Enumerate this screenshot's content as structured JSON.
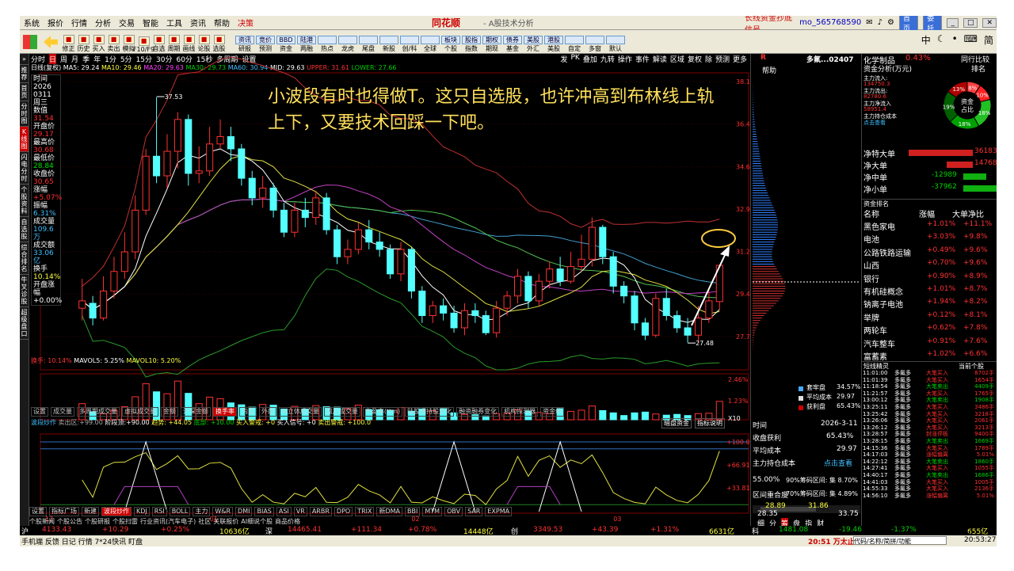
{
  "menu": [
    "系统",
    "报价",
    "行情",
    "分析",
    "交易",
    "智能",
    "工具",
    "资讯",
    "帮助",
    "决策"
  ],
  "brand": "同花顺",
  "app_title": "- A股技术分析",
  "top_right": {
    "signal": "长线资金抄底信号",
    "user": "mo_565768590",
    "btns": [
      "首页",
      "委托"
    ]
  },
  "toolbar": [
    {
      "l": "修正"
    },
    {
      "l": "历史"
    },
    {
      "l": "买入"
    },
    {
      "l": "卖出"
    },
    {
      "l": "模拟"
    },
    {
      "l": "F10/F9"
    },
    {
      "l": "自选"
    },
    {
      "l": "周期"
    },
    {
      "l": "画线"
    },
    {
      "l": "论股"
    },
    {
      "l": "选股"
    }
  ],
  "toolbar2": [
    {
      "t": "资讯",
      "l": "研报"
    },
    {
      "t": "竞价",
      "l": "预测"
    },
    {
      "t": "BBD",
      "l": "资金"
    },
    {
      "t": "陆港",
      "l": "两融"
    },
    {
      "t": "",
      "l": "热点"
    },
    {
      "t": "",
      "l": "龙虎"
    },
    {
      "t": "",
      "l": "尾盘"
    },
    {
      "t": "",
      "l": "新股"
    },
    {
      "t": "",
      "l": "创/科"
    },
    {
      "t": "",
      "l": "全球"
    },
    {
      "t": "板块",
      "l": "个股"
    },
    {
      "t": "股指",
      "l": "指数"
    },
    {
      "t": "期权",
      "l": "期现"
    },
    {
      "t": "债券",
      "l": "基金"
    },
    {
      "t": "美股",
      "l": "外汇"
    },
    {
      "t": "港股",
      "l": "美股"
    },
    {
      "t": "",
      "l": "自定"
    },
    {
      "t": "",
      "l": "多窗"
    },
    {
      "t": "",
      "l": "默认"
    }
  ],
  "side_tabs": [
    "分时图",
    "K线图",
    "闪电分时",
    "个股资料",
    "自选股",
    "综合排名",
    "牛叉诊股",
    "超级盘口"
  ],
  "period_bar": [
    "分时",
    "日",
    "周",
    "月",
    "季",
    "年",
    "1分",
    "5分",
    "15分",
    "30分",
    "60分",
    "15秒",
    "多周期",
    "设置"
  ],
  "period_right": [
    "发",
    "PK",
    "叠加",
    "九转",
    "操作",
    "事件",
    "解读",
    "区域",
    "复权",
    "除",
    "预测",
    "更多"
  ],
  "legend": {
    "stock": "日线(复权)",
    "ma5": "MA5: 29.24",
    "ma10": "MA10: 29.46",
    "ma20": "MA20: 29.63",
    "ma30": "MA30: 29.73",
    "ma60": "MA60: 30.94",
    "mid": "MID: 29.63",
    "upper": "UPPER: 31.61",
    "lower": "LOWER: 27.66"
  },
  "info": [
    {
      "k": "时间",
      "v": "2026"
    },
    {
      "k": "",
      "v": "0311"
    },
    {
      "k": "周三",
      "v": ""
    },
    {
      "k": "数值",
      "v": "31.54"
    },
    {
      "k": "开盘价",
      "v": "29.17"
    },
    {
      "k": "最高价",
      "v": "30.68"
    },
    {
      "k": "最低价",
      "v": "28.84"
    },
    {
      "k": "收盘价",
      "v": "30.65"
    },
    {
      "k": "涨幅",
      "v": "+5.07%"
    },
    {
      "k": "振幅",
      "v": "6.31%"
    },
    {
      "k": "成交量",
      "v": "109.6万"
    },
    {
      "k": "成交额",
      "v": "33.06亿"
    },
    {
      "k": "换手",
      "v": "10.14%"
    },
    {
      "k": "开盘涨幅",
      "v": "+0.00%"
    }
  ],
  "annotation": "小波段有时也得做T。这只自选股，也许冲高到布林线上轨上下，又要技术回踩一下吧。",
  "price_axis": [
    "38.14",
    "36.41",
    "34.67",
    "32.94",
    "31.21",
    "29.48",
    "27.75"
  ],
  "price_labels": {
    "high": "37.53",
    "low": "27.48"
  },
  "vol_legend": {
    "turn": "换手: 10.14%",
    "mavol5": "MAVOL5: 5.25%",
    "mavol10": "MAVOL10: 5.20%"
  },
  "vol_axis": [
    "2.46%",
    "1.23%",
    "X10"
  ],
  "ind_tabs": [
    "设置",
    "成交量",
    "多周期成交量",
    "虚拟成交量",
    "金额",
    "沪深金额",
    "换手率",
    "内盘",
    "外盘",
    "AI立体成交量",
    "盘后成交量",
    "市盈率(ttm)",
    "陆股通持股变化",
    "融资融券变化",
    "机构探测器",
    "资金统"
  ],
  "ind2_legend": {
    "name": "波段炒作",
    "a": "卖出区:+99.00",
    "b": "阶段顶:+90.00",
    "c": "趋势: +44.05",
    "d": "底部: +10.00",
    "e": "买入警戒: +0",
    "f": "买入信号: +0",
    "g": "卖出警戒: +100.0"
  },
  "ind2_right": [
    "暗盘资金",
    "指标说明"
  ],
  "ind2_axis": [
    "+100.0",
    "+66.91",
    "+33.81"
  ],
  "date_axis": [
    "12",
    "01",
    "02",
    "03"
  ],
  "bottom_tabs": [
    "设置",
    "指标广场",
    "新建",
    "波段炒作",
    "KDJ",
    "RSI",
    "BOLL",
    "主力",
    "W&R",
    "DMI",
    "BIAS",
    "ASI",
    "VR",
    "ARBR",
    "DPO",
    "TRIX",
    "新DMA",
    "BBI",
    "MTM",
    "OBV",
    "SAR",
    "EXPMA"
  ],
  "bottom_tabs2": [
    "个股新闻",
    "个股公告",
    "个股研报",
    "个股扫雷",
    "行业资讯(汽车电子)",
    "社区",
    "关联报价",
    "AI细说个股",
    "商品价格"
  ],
  "index_bar": {
    "sh": "沪",
    "sh_v": "4133.43",
    "sh_c": "+10.29",
    "sh_p": "+0.25%",
    "sh_a": "10636亿",
    "sz": "深",
    "sz_v": "14465.41",
    "sz_c": "+111.34",
    "sz_p": "+0.78%",
    "sz_a": "14448亿",
    "cy": "创",
    "cy_v": "3349.53",
    "cy_c": "+43.39",
    "cy_p": "+1.31%",
    "cy_a": "6631亿",
    "kc": "科",
    "kc_v": "1481.08",
    "kc_c": "-19.46",
    "kc_p": "-1.37%",
    "kc_a": "655亿"
  },
  "status": {
    "left": "手机端 反馈 日记 行情 7*24快讯 盯盘",
    "time": "20:51 万太止美",
    "search": "代码/名称/简拼/功能",
    "clock": "20:53:27",
    "clock2": "20:53"
  },
  "mid_panel": {
    "code": "R",
    "name": "多氟...02407",
    "help": "帮助",
    "chip_legend": [
      {
        "k": "套牢盘",
        "v": "34.57%"
      },
      {
        "k": "平均成本",
        "v": "29.97"
      },
      {
        "k": "获利盘",
        "v": "65.43%"
      }
    ],
    "date_k": "时间",
    "date_v": "2026-3-11",
    "profit_k": "收盘获利",
    "profit_v": "65.43%",
    "avg_k": "平均成本",
    "avg_v": "29.97",
    "main_k": "主力持仓成本",
    "main_v": "点击查看",
    "r90": "55.00%",
    "r90_t": "90%筹码区间: 集 8.70%",
    "r70": "区间重合度",
    "r70_t": "70%筹码区间: 集 4.89%",
    "lo": "28.89",
    "hi": "31.86",
    "lo2": "28.35",
    "hi2": "33.75",
    "tabs": [
      "细",
      "分",
      "筹",
      "盘",
      "指",
      "财"
    ]
  },
  "right_panel": {
    "sector": "化学制品",
    "sector_p": "0.43%",
    "ops": [
      "同行比较",
      "排名"
    ],
    "flow_title": "资金分析(万元)",
    "flow": [
      {
        "k": "主力流入:",
        "v": "134750.3"
      },
      {
        "k": "主力流出:",
        "v": "82780.6"
      },
      {
        "k": "主力净流入",
        "v": "58951.4"
      },
      {
        "k": "主力持仓成本",
        "v": "点击查看"
      }
    ],
    "pie": [
      {
        "l": "8%"
      },
      {
        "l": "10%"
      },
      {
        "l": "18%"
      },
      {
        "l": "18%"
      },
      {
        "l": "19%"
      },
      {
        "l": "13%"
      }
    ],
    "pie_center": "资金\n占比",
    "net": [
      {
        "k": "净特大单",
        "v": "36183"
      },
      {
        "k": "净大单",
        "v": "14768"
      },
      {
        "k": "净中单",
        "v": "-12989"
      },
      {
        "k": "净小单",
        "v": "-37962"
      }
    ],
    "rank_title": "资金排名",
    "rank_head": [
      "名称",
      "涨幅",
      "大单净比"
    ],
    "rank": [
      {
        "n": "黑色家电",
        "p": "+1.01%",
        "v": "+11.1%"
      },
      {
        "n": "电池",
        "p": "+3.03%",
        "v": "+9.8%"
      },
      {
        "n": "公路铁路运输",
        "p": "+0.49%",
        "v": "+9.6%"
      },
      {
        "n": "山西",
        "p": "+0.70%",
        "v": "+9.6%"
      },
      {
        "n": "银行",
        "p": "+0.90%",
        "v": "+8.9%"
      },
      {
        "n": "有机硅概念",
        "p": "+1.01%",
        "v": "+8.7%"
      },
      {
        "n": "钠离子电池",
        "p": "+1.94%",
        "v": "+8.2%"
      },
      {
        "n": "举牌",
        "p": "+0.12%",
        "v": "+8.1%"
      },
      {
        "n": "两轮车",
        "p": "+0.62%",
        "v": "+7.8%"
      },
      {
        "n": "汽车整车",
        "p": "+0.91%",
        "v": "+7.6%"
      },
      {
        "n": "富蓄素",
        "p": "+1.02%",
        "v": "+6.6%"
      }
    ],
    "trade_title": "短线精灵",
    "trade_filter": "当前个股",
    "trades": [
      {
        "t": "11:01:00",
        "n": "多氟多",
        "a": "大笔买入",
        "v": "8702手"
      },
      {
        "t": "11:01:39",
        "n": "多氟多",
        "a": "大笔买入",
        "v": "1654手"
      },
      {
        "t": "11:18:54",
        "n": "多氟多",
        "a": "大笔卖出",
        "v": "4409手"
      },
      {
        "t": "11:21:57",
        "n": "多氟多",
        "a": "大笔买入",
        "v": "1765手"
      },
      {
        "t": "13:00:12",
        "n": "多氟多",
        "a": "大笔卖出",
        "v": "1908手"
      },
      {
        "t": "13:25:11",
        "n": "多氟多",
        "a": "大笔买入",
        "v": "3486手"
      },
      {
        "t": "13:25:42",
        "n": "多氟多",
        "a": "大笔买入",
        "v": "3218手"
      },
      {
        "t": "13:26:06",
        "n": "多氟多",
        "a": "大笔买入",
        "v": "2061手"
      },
      {
        "t": "13:26:12",
        "n": "多氟多",
        "a": "大笔买入",
        "v": "3213手"
      },
      {
        "t": "13:28:57",
        "n": "多氟多",
        "a": "封涨停板",
        "v": "9400手"
      },
      {
        "t": "13:28:15",
        "n": "多氟多",
        "a": "大笔卖出",
        "v": "1669手"
      },
      {
        "t": "14:15:36",
        "n": "多氟多",
        "a": "大笔买入",
        "v": "1789手"
      },
      {
        "t": "14:17:03",
        "n": "多氟多",
        "a": "涨幅偏离",
        "v": "5.01%"
      },
      {
        "t": "14:22:12",
        "n": "多氟多",
        "a": "大笔卖出",
        "v": "1860手"
      },
      {
        "t": "14:27:41",
        "n": "多氟多",
        "a": "大笔买入",
        "v": "1055手"
      },
      {
        "t": "14:40:17",
        "n": "多氟多",
        "a": "大笔卖出",
        "v": "1686手"
      },
      {
        "t": "14:41:03",
        "n": "多氟多",
        "a": "大笔买入",
        "v": "1005手"
      },
      {
        "t": "14:55:33",
        "n": "多氟多",
        "a": "大笔买入",
        "v": "2136手"
      },
      {
        "t": "14:56:10",
        "n": "多氟多",
        "a": "涨幅偏离",
        "v": "5.01%"
      }
    ]
  },
  "chart_data": {
    "type": "candlestick",
    "title": "日线(复权)",
    "ylim": [
      27.0,
      38.5
    ],
    "candles": [
      [
        28.9,
        29.2,
        30.1,
        28.4
      ],
      [
        29.1,
        28.5,
        29.4,
        28.2
      ],
      [
        28.5,
        29.6,
        30.2,
        28.4
      ],
      [
        29.6,
        30.4,
        31.0,
        29.3
      ],
      [
        30.4,
        31.2,
        32.0,
        30.1
      ],
      [
        31.2,
        32.9,
        33.5,
        30.9
      ],
      [
        32.9,
        35.1,
        35.4,
        32.7
      ],
      [
        35.1,
        34.3,
        37.5,
        34.0
      ],
      [
        34.3,
        35.3,
        36.0,
        33.8
      ],
      [
        35.3,
        36.6,
        36.9,
        34.6
      ],
      [
        36.6,
        34.4,
        36.8,
        33.9
      ],
      [
        34.4,
        34.5,
        35.5,
        34.0
      ],
      [
        34.5,
        35.6,
        36.3,
        34.3
      ],
      [
        35.6,
        35.9,
        36.6,
        35.4
      ],
      [
        35.9,
        35.4,
        36.3,
        34.9
      ],
      [
        35.4,
        34.2,
        35.6,
        33.9
      ],
      [
        34.2,
        33.4,
        34.5,
        33.1
      ],
      [
        33.4,
        33.8,
        34.3,
        33.0
      ],
      [
        33.8,
        32.9,
        34.0,
        32.6
      ],
      [
        32.9,
        32.0,
        33.2,
        31.8
      ],
      [
        32.0,
        32.9,
        33.2,
        31.8
      ],
      [
        32.9,
        32.6,
        33.4,
        32.2
      ],
      [
        32.6,
        33.4,
        33.7,
        32.3
      ],
      [
        33.4,
        32.1,
        33.6,
        31.9
      ],
      [
        32.1,
        31.0,
        32.3,
        30.7
      ],
      [
        31.0,
        31.3,
        31.7,
        30.7
      ],
      [
        31.3,
        32.1,
        32.4,
        31.1
      ],
      [
        32.1,
        31.6,
        32.5,
        31.3
      ],
      [
        31.6,
        31.3,
        32.0,
        31.0
      ],
      [
        31.3,
        30.3,
        31.5,
        30.1
      ],
      [
        30.3,
        31.3,
        31.6,
        30.0
      ],
      [
        31.3,
        29.6,
        31.4,
        29.3
      ],
      [
        29.6,
        28.6,
        29.8,
        28.3
      ],
      [
        28.6,
        29.0,
        29.2,
        28.3
      ],
      [
        29.0,
        28.7,
        29.3,
        28.4
      ],
      [
        28.7,
        28.1,
        29.0,
        27.9
      ],
      [
        28.1,
        28.8,
        29.1,
        27.8
      ],
      [
        28.8,
        28.6,
        29.1,
        28.3
      ],
      [
        28.6,
        27.9,
        28.8,
        27.8
      ],
      [
        27.9,
        28.9,
        29.2,
        27.7
      ],
      [
        28.9,
        29.4,
        29.6,
        28.6
      ],
      [
        29.4,
        30.2,
        30.5,
        29.1
      ],
      [
        30.2,
        29.2,
        30.4,
        28.9
      ],
      [
        29.2,
        30.0,
        30.3,
        29.0
      ],
      [
        30.0,
        30.5,
        30.8,
        29.7
      ],
      [
        30.5,
        30.0,
        31.0,
        29.8
      ],
      [
        30.0,
        30.6,
        31.2,
        29.9
      ],
      [
        30.6,
        30.9,
        31.9,
        30.4
      ],
      [
        30.9,
        32.2,
        32.6,
        30.6
      ],
      [
        32.2,
        31.0,
        32.3,
        30.7
      ],
      [
        31.0,
        29.8,
        31.2,
        29.5
      ],
      [
        29.8,
        29.4,
        30.0,
        29.1
      ],
      [
        29.4,
        28.3,
        29.6,
        28.0
      ],
      [
        28.3,
        27.8,
        28.5,
        27.6
      ],
      [
        27.8,
        29.3,
        29.5,
        27.7
      ],
      [
        29.3,
        28.6,
        29.7,
        28.4
      ],
      [
        28.6,
        28.1,
        28.8,
        27.9
      ],
      [
        28.1,
        27.8,
        28.5,
        27.5
      ],
      [
        27.8,
        28.5,
        29.0,
        27.5
      ],
      [
        28.5,
        29.2,
        29.6,
        28.3
      ],
      [
        29.17,
        30.65,
        30.68,
        28.84
      ]
    ],
    "volume_percent": [
      4.2,
      2.1,
      1.6,
      2.5,
      3.4,
      6.0,
      9.4,
      7.3,
      6.8,
      10.1,
      6.9,
      4.2,
      5.9,
      5.5,
      4.4,
      3.9,
      3.3,
      4.0,
      3.8,
      2.8,
      3.5,
      2.8,
      3.7,
      3.4,
      3.3,
      2.9,
      3.8,
      2.6,
      2.6,
      2.5,
      3.2,
      2.2,
      2.8,
      2.4,
      2.9,
      1.8,
      1.4,
      1.3,
      1.0,
      1.6,
      1.7,
      2.6,
      2.3,
      1.9,
      1.6,
      2.9,
      2.2,
      2.5,
      3.6,
      2.4,
      1.8,
      1.1,
      1.8,
      2.0,
      1.5,
      1.2,
      1.4,
      1.1,
      1.6,
      1.7,
      4.8
    ]
  }
}
